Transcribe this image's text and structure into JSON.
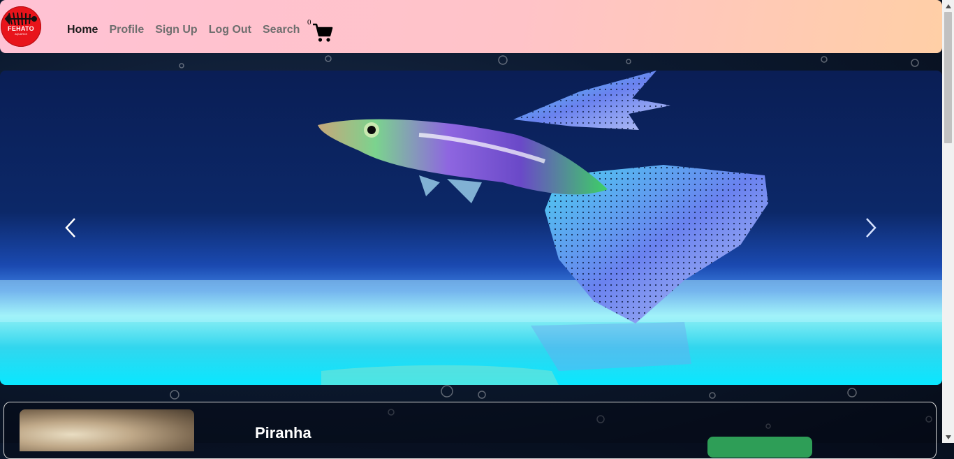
{
  "logo": {
    "name": "FEHATO",
    "tagline": "AQUATICS"
  },
  "nav": {
    "items": [
      {
        "label": "Home",
        "active": true
      },
      {
        "label": "Profile",
        "active": false
      },
      {
        "label": "Sign Up",
        "active": false
      },
      {
        "label": "Log Out",
        "active": false
      },
      {
        "label": "Search",
        "active": false
      }
    ]
  },
  "cart": {
    "count": "0",
    "icon": "shopping-cart-icon"
  },
  "carousel": {
    "prev_icon": "chevron-left-icon",
    "next_icon": "chevron-right-icon"
  },
  "product": {
    "name": "Piranha"
  },
  "colors": {
    "navbar_start": "#ffc2d4",
    "navbar_end": "#ffcfa6",
    "buy_button": "#2e9e57"
  }
}
